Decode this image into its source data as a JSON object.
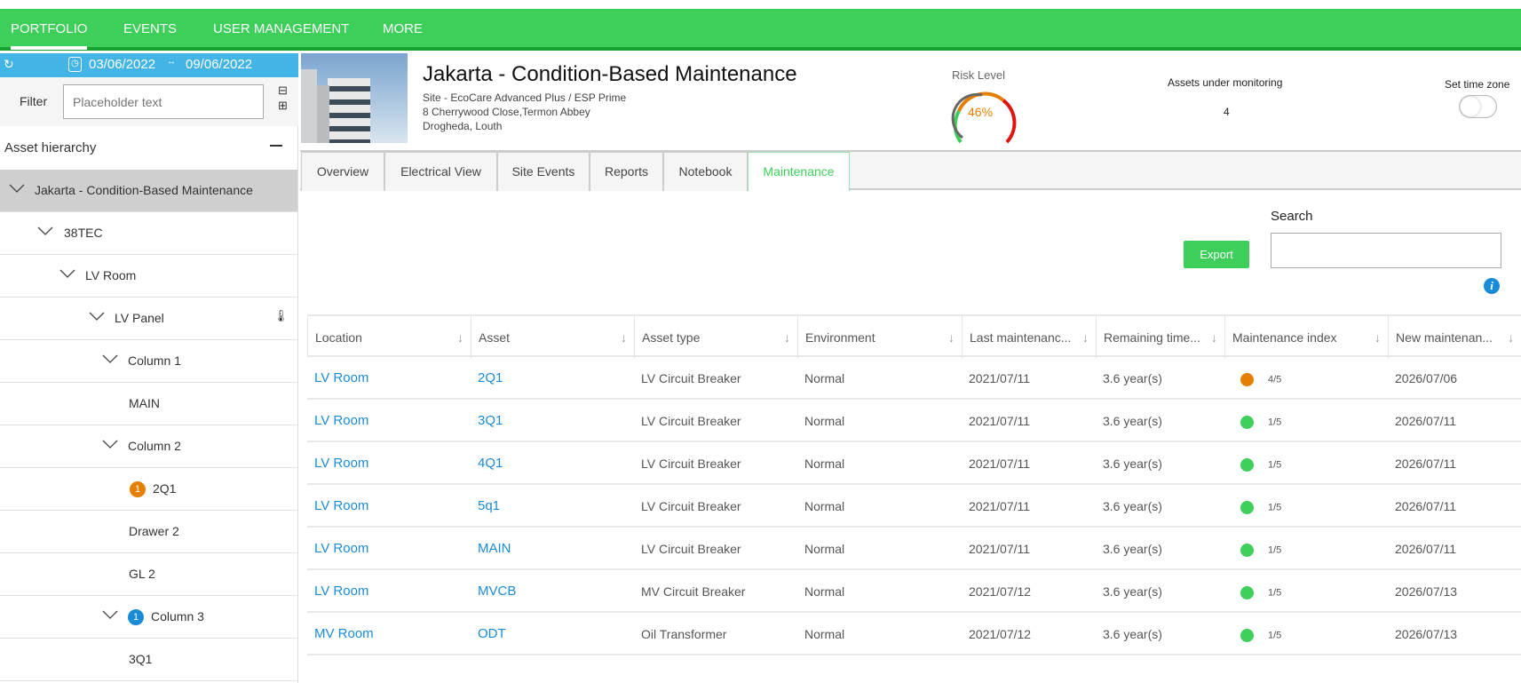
{
  "nav": {
    "items": [
      {
        "label": "PORTFOLIO",
        "active": true
      },
      {
        "label": "EVENTS"
      },
      {
        "label": "USER MANAGEMENT"
      },
      {
        "label": "MORE"
      }
    ]
  },
  "datebar": {
    "start": "03/06/2022",
    "end": "09/06/2022"
  },
  "filter": {
    "label": "Filter",
    "placeholder": "Placeholder text"
  },
  "hierarchy": {
    "title": "Asset hierarchy",
    "collapse_icon": "minus-icon",
    "items": [
      {
        "label": "Jakarta - Condition-Based Maintenance",
        "level": 0,
        "expanded": true,
        "selected": true
      },
      {
        "label": "38TEC",
        "level": 1,
        "expanded": true
      },
      {
        "label": "LV Room",
        "level": 2,
        "expanded": true
      },
      {
        "label": "LV Panel",
        "level": 3,
        "expanded": true,
        "icon": "thermometer-icon"
      },
      {
        "label": "Column 1",
        "level": 4,
        "expanded": true
      },
      {
        "label": "MAIN",
        "level": 5
      },
      {
        "label": "Column 2",
        "level": 4,
        "expanded": true
      },
      {
        "label": "2Q1",
        "level": 5,
        "badge": "1",
        "badge_color": "#e47f00"
      },
      {
        "label": "Drawer 2",
        "level": 5
      },
      {
        "label": "GL 2",
        "level": 5
      },
      {
        "label": "Column 3",
        "level": 4,
        "expanded": true,
        "badge": "1",
        "badge_color": "#1a8bd6"
      },
      {
        "label": "3Q1",
        "level": 5
      }
    ]
  },
  "site": {
    "title": "Jakarta - Condition-Based Maintenance",
    "line1": "Site - EcoCare Advanced Plus / ESP Prime",
    "line2": "8 Cherrywood Close,Termon Abbey",
    "line3": "Drogheda, Louth"
  },
  "risk": {
    "label": "Risk Level",
    "value": "46%",
    "percent": 46
  },
  "assets": {
    "label": "Assets under monitoring",
    "value": "4"
  },
  "timezone": {
    "label": "Set time zone",
    "enabled": false
  },
  "tabs": [
    {
      "label": "Overview"
    },
    {
      "label": "Electrical View"
    },
    {
      "label": "Site Events"
    },
    {
      "label": "Reports"
    },
    {
      "label": "Notebook"
    },
    {
      "label": "Maintenance",
      "active": true
    }
  ],
  "toolbar": {
    "export": "Export",
    "search_label": "Search",
    "search_value": ""
  },
  "table": {
    "columns": [
      "Location",
      "Asset",
      "Asset type",
      "Environment",
      "Last maintenanc...",
      "Remaining time...",
      "Maintenance index",
      "New maintenan..."
    ],
    "rows": [
      {
        "location": "LV Room",
        "asset": "2Q1",
        "type": "LV Circuit Breaker",
        "env": "Normal",
        "last": "2021/07/11",
        "remaining": "3.6 year(s)",
        "index": "4/5",
        "color": "#e47f00",
        "next": "2026/07/06"
      },
      {
        "location": "LV Room",
        "asset": "3Q1",
        "type": "LV Circuit Breaker",
        "env": "Normal",
        "last": "2021/07/11",
        "remaining": "3.6 year(s)",
        "index": "1/5",
        "color": "#3ecf5a",
        "next": "2026/07/11"
      },
      {
        "location": "LV Room",
        "asset": "4Q1",
        "type": "LV Circuit Breaker",
        "env": "Normal",
        "last": "2021/07/11",
        "remaining": "3.6 year(s)",
        "index": "1/5",
        "color": "#3ecf5a",
        "next": "2026/07/11"
      },
      {
        "location": "LV Room",
        "asset": "5q1",
        "type": "LV Circuit Breaker",
        "env": "Normal",
        "last": "2021/07/11",
        "remaining": "3.6 year(s)",
        "index": "1/5",
        "color": "#3ecf5a",
        "next": "2026/07/11"
      },
      {
        "location": "LV Room",
        "asset": "MAIN",
        "type": "LV Circuit Breaker",
        "env": "Normal",
        "last": "2021/07/11",
        "remaining": "3.6 year(s)",
        "index": "1/5",
        "color": "#3ecf5a",
        "next": "2026/07/11"
      },
      {
        "location": "LV Room",
        "asset": "MVCB",
        "type": "MV Circuit Breaker",
        "env": "Normal",
        "last": "2021/07/12",
        "remaining": "3.6 year(s)",
        "index": "1/5",
        "color": "#3ecf5a",
        "next": "2026/07/13"
      },
      {
        "location": "MV Room",
        "asset": "ODT",
        "type": "Oil Transformer",
        "env": "Normal",
        "last": "2021/07/12",
        "remaining": "3.6 year(s)",
        "index": "1/5",
        "color": "#3ecf5a",
        "next": "2026/07/13"
      }
    ]
  }
}
